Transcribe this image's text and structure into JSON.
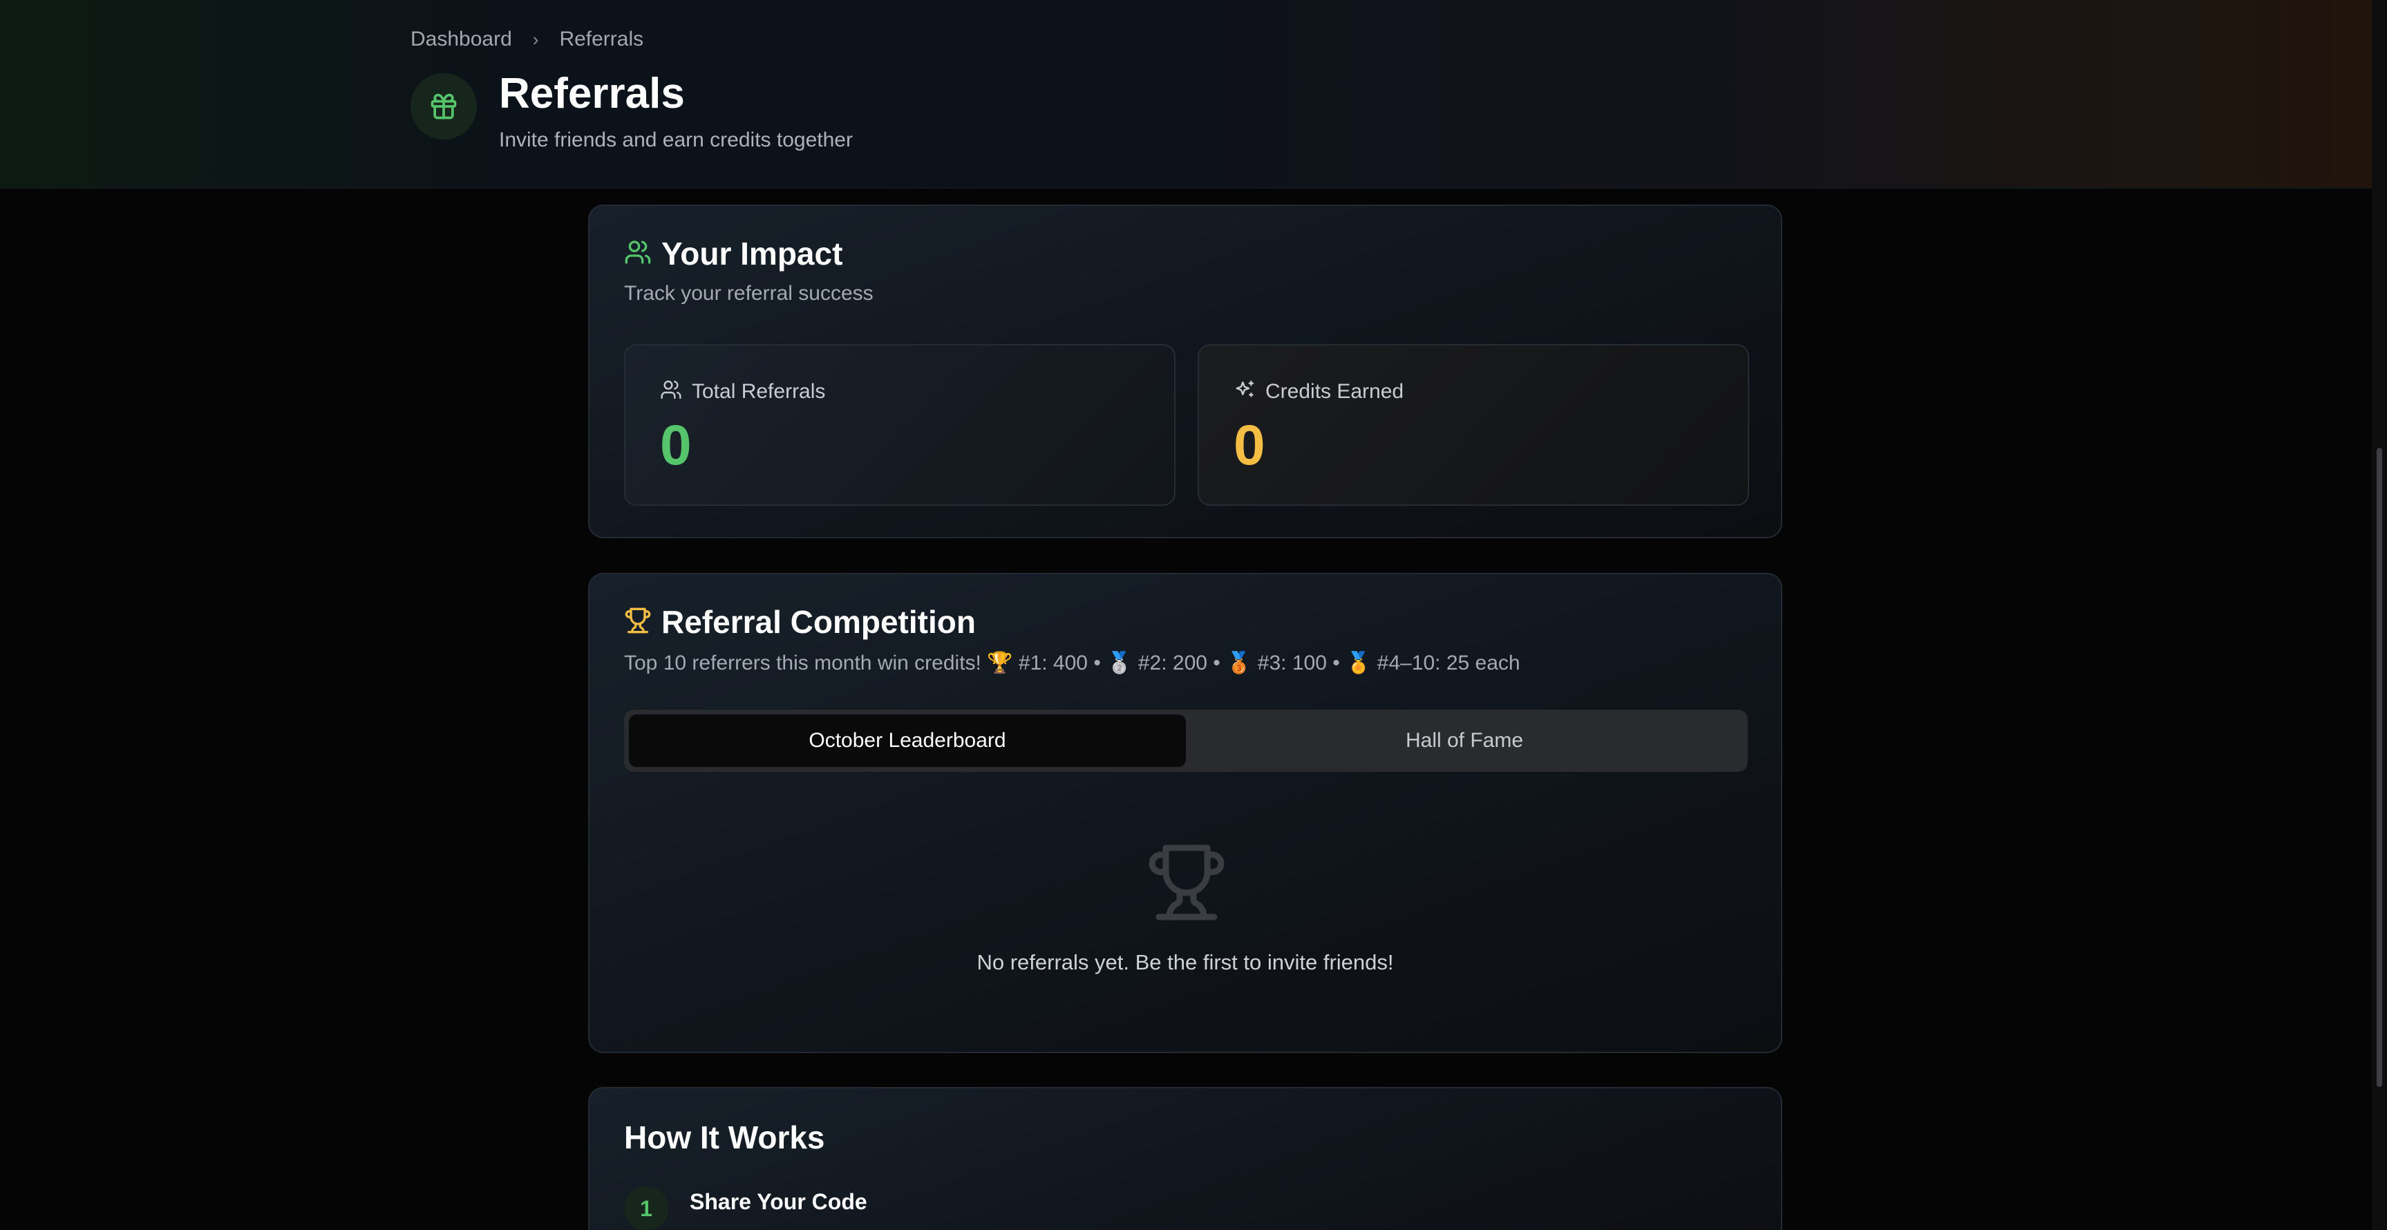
{
  "header": {
    "breadcrumb": {
      "root": "Dashboard",
      "current": "Referrals"
    },
    "title": "Referrals",
    "subtitle": "Invite friends and earn credits together",
    "icon": "gift-icon",
    "accent": "#55c46a"
  },
  "impact": {
    "title": "Your Impact",
    "subtitle": "Track your referral success",
    "stats": [
      {
        "label": "Total Referrals",
        "value": "0",
        "icon": "users-icon",
        "color": "#55c46a"
      },
      {
        "label": "Credits Earned",
        "value": "0",
        "icon": "sparkles-icon",
        "color": "#f4be45"
      }
    ]
  },
  "competition": {
    "title": "Referral Competition",
    "subtitle": "Top 10 referrers this month win credits! 🏆 #1: 400 • 🥈 #2: 200 • 🥉 #3: 100 • 🏅 #4–10: 25 each",
    "tabs": [
      {
        "label": "October Leaderboard",
        "active": true
      },
      {
        "label": "Hall of Fame",
        "active": false
      }
    ],
    "empty_message": "No referrals yet. Be the first to invite friends!"
  },
  "how_it_works": {
    "title": "How It Works",
    "steps": [
      {
        "number": "1",
        "title": "Share Your Code"
      }
    ]
  }
}
